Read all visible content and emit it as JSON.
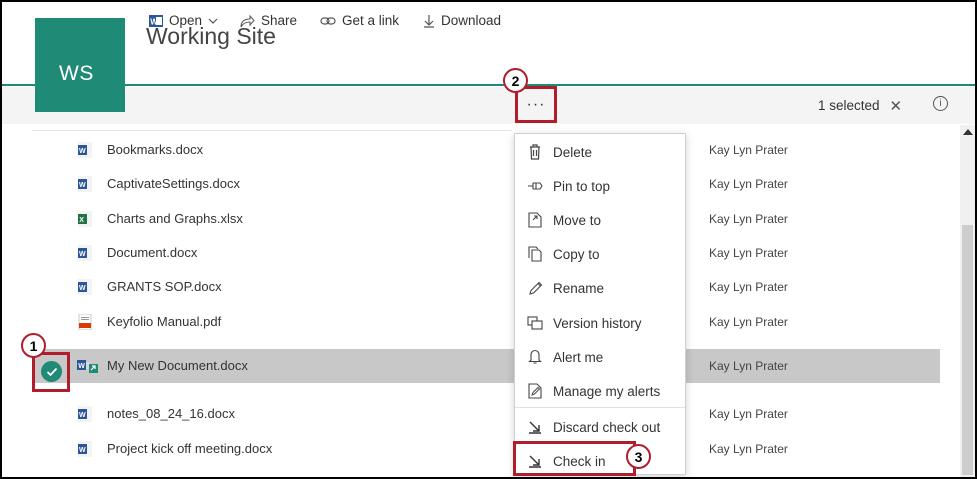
{
  "site": {
    "logo_text": "WS",
    "title": "Working Site"
  },
  "commandbar": {
    "open_label": "Open",
    "share_label": "Share",
    "link_label": "Get a link",
    "download_label": "Download",
    "more_label": "···",
    "selected_label": "1 selected",
    "clear_label": "✕",
    "info_label": "i"
  },
  "files": [
    {
      "name": "Bookmarks.docx",
      "type": "word",
      "modified_by": "Kay Lyn Prater"
    },
    {
      "name": "CaptivateSettings.docx",
      "type": "word",
      "modified_by": "Kay Lyn Prater"
    },
    {
      "name": "Charts and Graphs.xlsx",
      "type": "excel",
      "modified_by": "Kay Lyn Prater"
    },
    {
      "name": "Document.docx",
      "type": "word",
      "modified_by": "Kay Lyn Prater"
    },
    {
      "name": "GRANTS SOP.docx",
      "type": "word",
      "modified_by": "Kay Lyn Prater"
    },
    {
      "name": "Keyfolio Manual.pdf",
      "type": "pdf",
      "modified_by": "Kay Lyn Prater"
    },
    {
      "name": "My New Document.docx",
      "type": "word-checkedout",
      "modified_by": "Kay Lyn Prater",
      "selected": true
    },
    {
      "name": "notes_08_24_16.docx",
      "type": "word",
      "modified_by": "Kay Lyn Prater"
    },
    {
      "name": "Project kick off meeting.docx",
      "type": "word",
      "modified_by": "Kay Lyn Prater"
    }
  ],
  "menu": {
    "items": [
      {
        "label": "Delete",
        "icon": "trash-icon"
      },
      {
        "label": "Pin to top",
        "icon": "pin-icon"
      },
      {
        "label": "Move to",
        "icon": "move-icon"
      },
      {
        "label": "Copy to",
        "icon": "copy-icon"
      },
      {
        "label": "Rename",
        "icon": "pencil-icon"
      },
      {
        "label": "Version history",
        "icon": "version-history-icon"
      },
      {
        "label": "Alert me",
        "icon": "bell-icon"
      },
      {
        "label": "Manage my alerts",
        "icon": "manage-alerts-icon"
      },
      {
        "label": "Discard check out",
        "icon": "discard-checkout-icon"
      },
      {
        "label": "Check in",
        "icon": "check-in-icon"
      }
    ]
  },
  "callouts": [
    "1",
    "2",
    "3"
  ],
  "colors": {
    "brand": "#1f8a75",
    "highlight": "#b01e2e",
    "selected_row": "#c8c8c8"
  }
}
